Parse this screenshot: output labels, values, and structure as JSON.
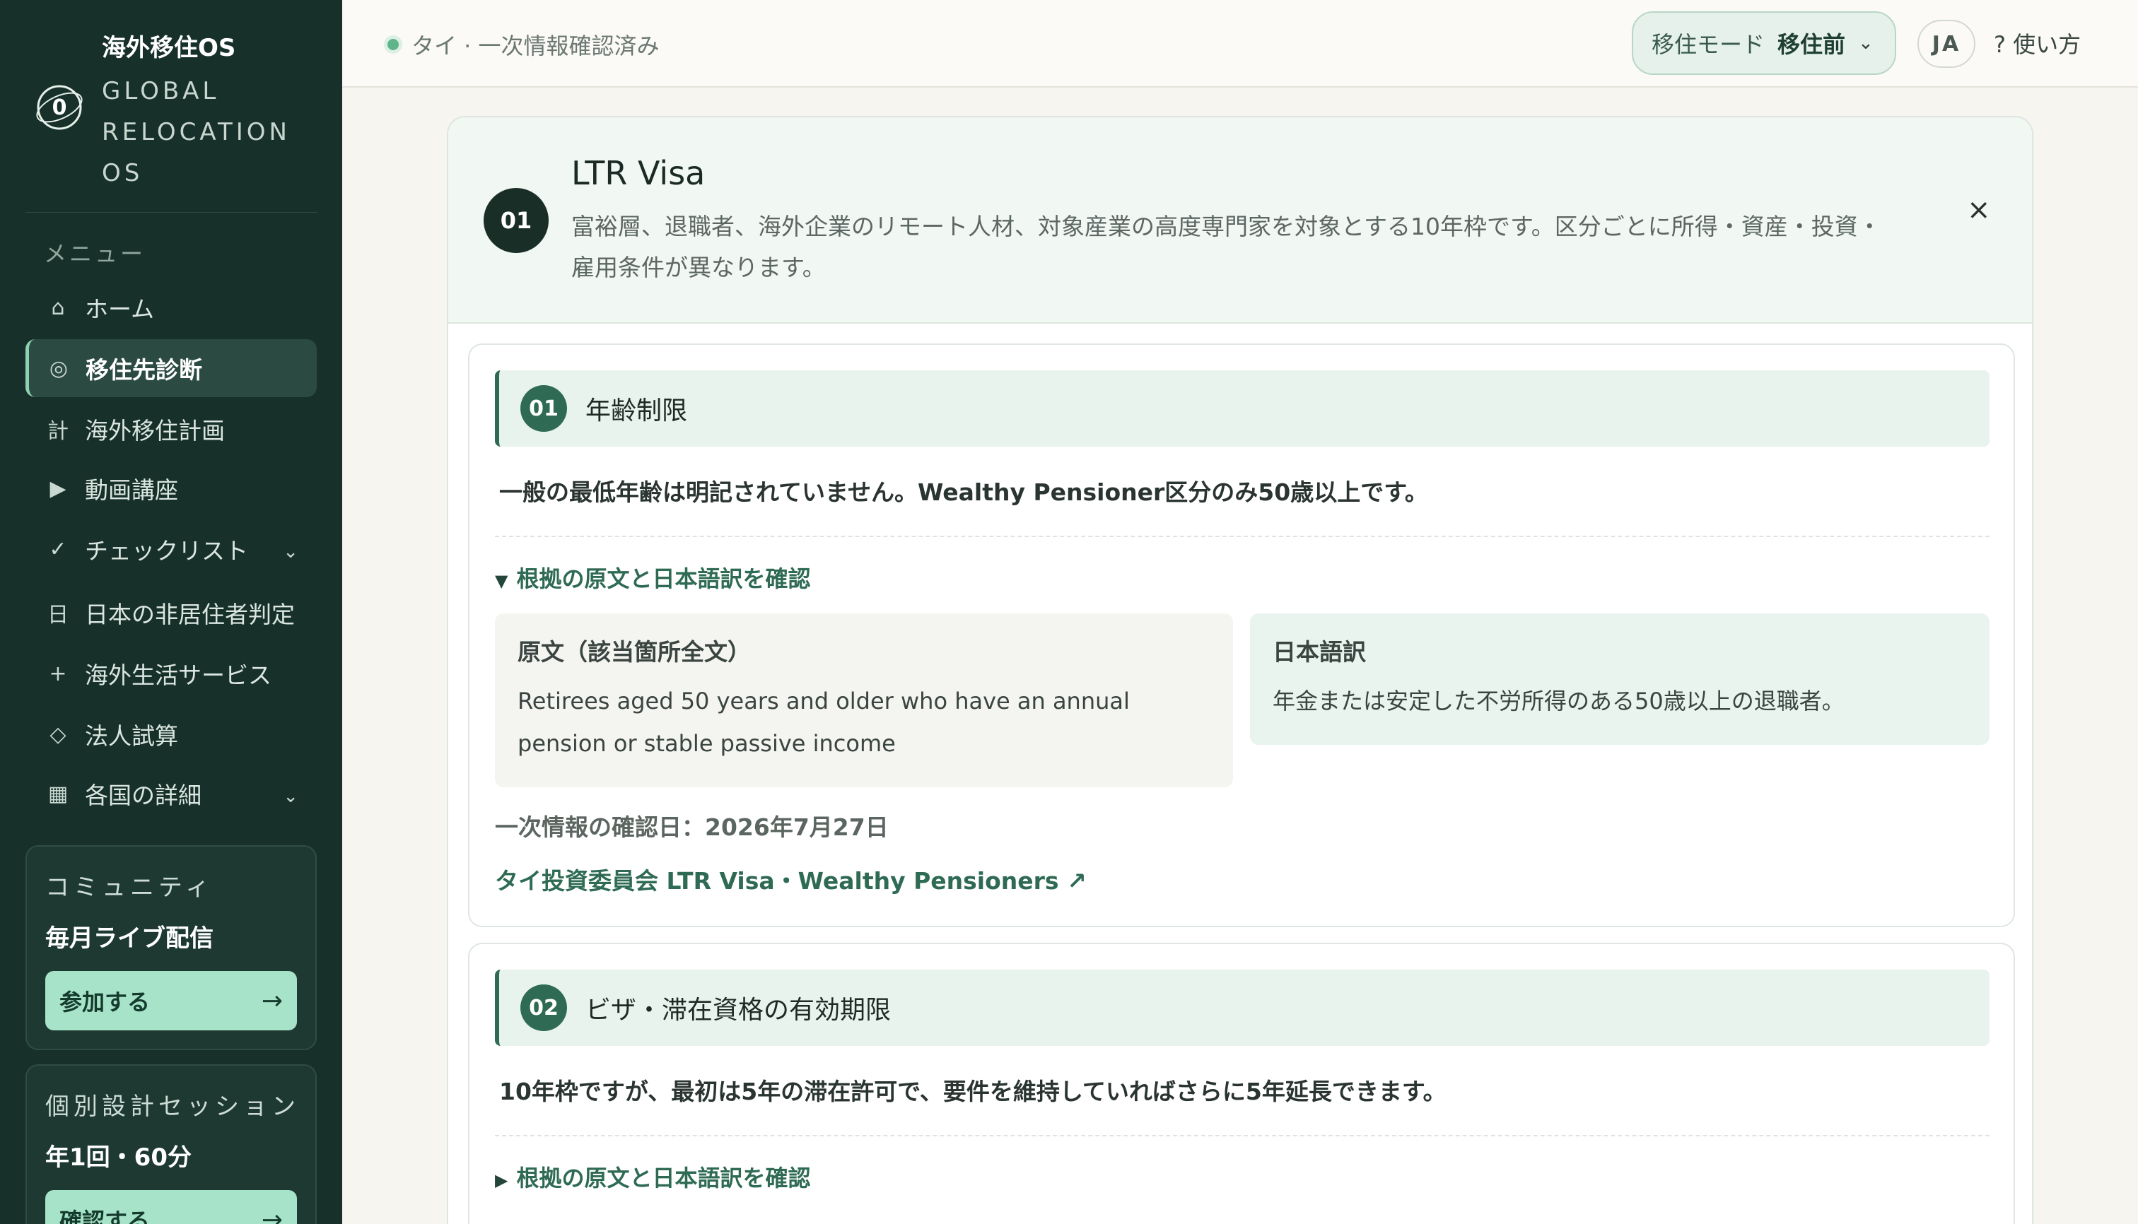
{
  "brand": {
    "name": "海外移住OS",
    "logo_letter": "0",
    "subtitle": "GLOBAL RELOCATION OS"
  },
  "sidebar": {
    "menu_caption": "メニュー",
    "items": [
      {
        "icon": "⌂",
        "label": "ホーム"
      },
      {
        "icon": "◎",
        "label": "移住先診断"
      },
      {
        "icon": "計",
        "label": "海外移住計画"
      },
      {
        "icon": "▶",
        "label": "動画講座"
      },
      {
        "icon": "✓",
        "label": "チェックリスト",
        "chevron": "⌄"
      },
      {
        "icon": "日",
        "label": "日本の非居住者判定"
      },
      {
        "icon": "+",
        "label": "海外生活サービス"
      },
      {
        "icon": "◇",
        "label": "法人試算"
      },
      {
        "icon": "▦",
        "label": "各国の詳細",
        "chevron": "⌄"
      }
    ],
    "community_card": {
      "caption": "コミュニティ",
      "title": "毎月ライブ配信",
      "button": "参加する",
      "arrow": "→"
    },
    "session_card": {
      "caption": "個別設計セッション",
      "title": "年1回・60分",
      "button": "確認する",
      "arrow": "→"
    }
  },
  "topbar": {
    "status": "タイ · 一次情報確認済み",
    "mode_label": "移住モード",
    "mode_value": "移住前",
    "mode_chevron": "⌄",
    "lang": "JA",
    "help": "? 使い方"
  },
  "panel": {
    "number": "01",
    "title": "LTR Visa",
    "description": "富裕層、退職者、海外企業のリモート人材、対象産業の高度専門家を対象とする10年枠です。区分ごとに所得・資産・投資・雇用条件が異なります。",
    "close": "×",
    "sections": [
      {
        "number": "01",
        "title": "年齢制限",
        "summary": "一般の最低年齢は明記されていません。Wealthy Pensioner区分のみ50歳以上です。",
        "toggle_icon": "▼",
        "toggle_label": "根拠の原文と日本語訳を確認",
        "source_label": "原文（該当箇所全文）",
        "source_text": "Retirees aged 50 years and older who have an annual pension or stable passive income",
        "translation_label": "日本語訳",
        "translation_text": "年金または安定した不労所得のある50歳以上の退職者。",
        "confirmed": "一次情報の確認日：2026年7月27日",
        "link": "タイ投資委員会 LTR Visa・Wealthy Pensioners ↗"
      },
      {
        "number": "02",
        "title": "ビザ・滞在資格の有効期限",
        "summary": "10年枠ですが、最初は5年の滞在許可で、要件を維持していればさらに5年延長できます。",
        "toggle_icon": "▶",
        "toggle_label": "根拠の原文と日本語訳を確認"
      }
    ]
  }
}
